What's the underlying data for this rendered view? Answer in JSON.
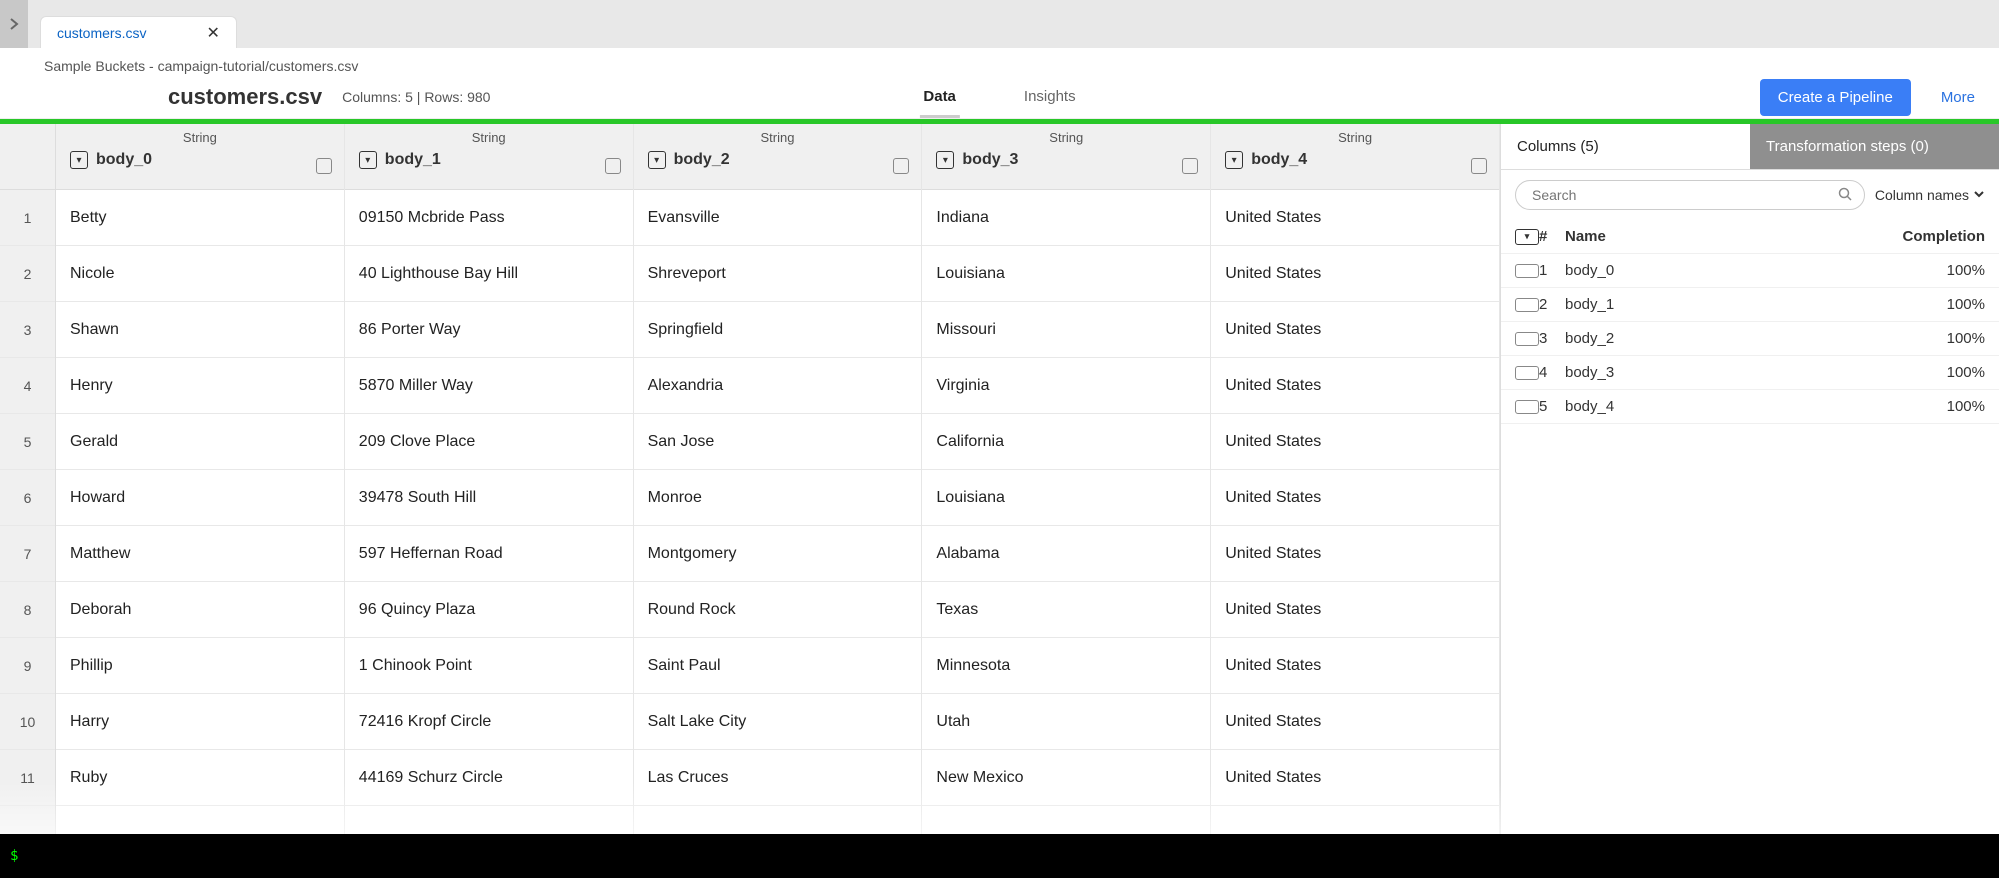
{
  "tab": {
    "label": "customers.csv"
  },
  "breadcrumb": "Sample Buckets - campaign-tutorial/customers.csv",
  "title": "customers.csv",
  "stats": "Columns: 5 | Rows: 980",
  "centerTabs": {
    "data": "Data",
    "insights": "Insights"
  },
  "actions": {
    "createPipeline": "Create a Pipeline",
    "more": "More"
  },
  "columns": [
    {
      "type": "String",
      "name": "body_0"
    },
    {
      "type": "String",
      "name": "body_1"
    },
    {
      "type": "String",
      "name": "body_2"
    },
    {
      "type": "String",
      "name": "body_3"
    },
    {
      "type": "String",
      "name": "body_4"
    }
  ],
  "rows": [
    [
      "Betty",
      "09150 Mcbride Pass",
      "Evansville",
      "Indiana",
      "United States"
    ],
    [
      "Nicole",
      "40 Lighthouse Bay Hill",
      "Shreveport",
      "Louisiana",
      "United States"
    ],
    [
      "Shawn",
      "86 Porter Way",
      "Springfield",
      "Missouri",
      "United States"
    ],
    [
      "Henry",
      "5870 Miller Way",
      "Alexandria",
      "Virginia",
      "United States"
    ],
    [
      "Gerald",
      "209 Clove Place",
      "San Jose",
      "California",
      "United States"
    ],
    [
      "Howard",
      "39478 South Hill",
      "Monroe",
      "Louisiana",
      "United States"
    ],
    [
      "Matthew",
      "597 Heffernan Road",
      "Montgomery",
      "Alabama",
      "United States"
    ],
    [
      "Deborah",
      "96 Quincy Plaza",
      "Round Rock",
      "Texas",
      "United States"
    ],
    [
      "Phillip",
      "1 Chinook Point",
      "Saint Paul",
      "Minnesota",
      "United States"
    ],
    [
      "Harry",
      "72416 Kropf Circle",
      "Salt Lake City",
      "Utah",
      "United States"
    ],
    [
      "Ruby",
      "44169 Schurz Circle",
      "Las Cruces",
      "New Mexico",
      "United States"
    ]
  ],
  "rightPanel": {
    "tabColumns": "Columns (5)",
    "tabSteps": "Transformation steps (0)",
    "searchPlaceholder": "Search",
    "filterLabel": "Column names",
    "header": {
      "num": "#",
      "name": "Name",
      "completion": "Completion"
    },
    "items": [
      {
        "num": "1",
        "name": "body_0",
        "completion": "100%"
      },
      {
        "num": "2",
        "name": "body_1",
        "completion": "100%"
      },
      {
        "num": "3",
        "name": "body_2",
        "completion": "100%"
      },
      {
        "num": "4",
        "name": "body_3",
        "completion": "100%"
      },
      {
        "num": "5",
        "name": "body_4",
        "completion": "100%"
      }
    ]
  },
  "terminal": "$"
}
